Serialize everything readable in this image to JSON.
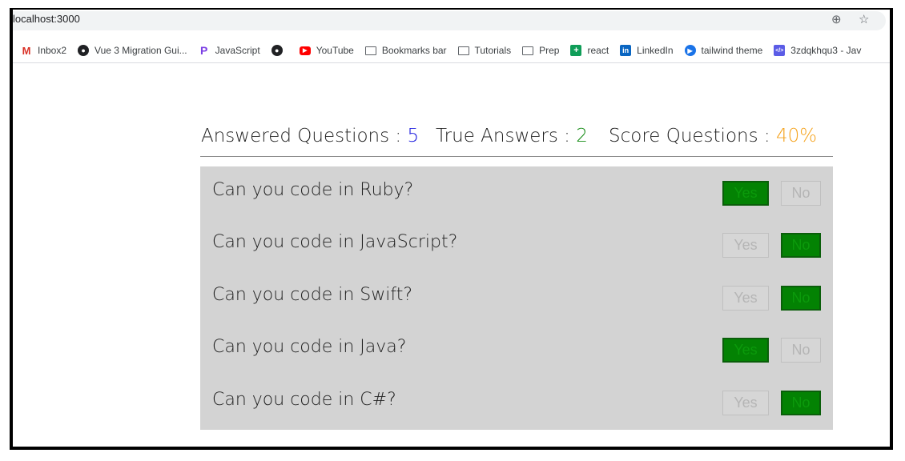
{
  "browser": {
    "url": "localhost:3000",
    "bookmarks": [
      {
        "label": "Inbox2",
        "icon": "gmail-icon"
      },
      {
        "label": "Vue 3 Migration Gui...",
        "icon": "globe-icon"
      },
      {
        "label": "JavaScript",
        "icon": "javascript-icon"
      },
      {
        "label": "",
        "icon": "globe-icon"
      },
      {
        "label": "YouTube",
        "icon": "youtube-icon"
      },
      {
        "label": "Bookmarks bar",
        "icon": "folder-icon"
      },
      {
        "label": "Tutorials",
        "icon": "folder-icon"
      },
      {
        "label": "Prep",
        "icon": "folder-icon"
      },
      {
        "label": "react",
        "icon": "sheets-icon"
      },
      {
        "label": "LinkedIn",
        "icon": "linkedin-icon"
      },
      {
        "label": "tailwind theme",
        "icon": "tailwind-icon"
      },
      {
        "label": "3zdqkhqu3 - Jav",
        "icon": "code-icon"
      }
    ]
  },
  "stats": {
    "answered_label": "Answered Questions : ",
    "answered_value": "5",
    "true_label": "True Answers : ",
    "true_value": "2",
    "score_label": "Score Questions : ",
    "score_value": "40%"
  },
  "questions": [
    {
      "text": "Can you code in Ruby?",
      "selected": "yes"
    },
    {
      "text": "Can you code in JavaScript?",
      "selected": "no"
    },
    {
      "text": "Can you code in Swift?",
      "selected": "no"
    },
    {
      "text": "Can you code in Java?",
      "selected": "yes"
    },
    {
      "text": "Can you code in C#?",
      "selected": "no"
    }
  ],
  "buttons": {
    "yes_label": "Yes",
    "no_label": "No"
  },
  "colors": {
    "answered": "#1a1adf",
    "true_answers": "#128a12",
    "score": "#f5a21b",
    "selected_button": "#038203",
    "panel": "#d3d3d3"
  }
}
